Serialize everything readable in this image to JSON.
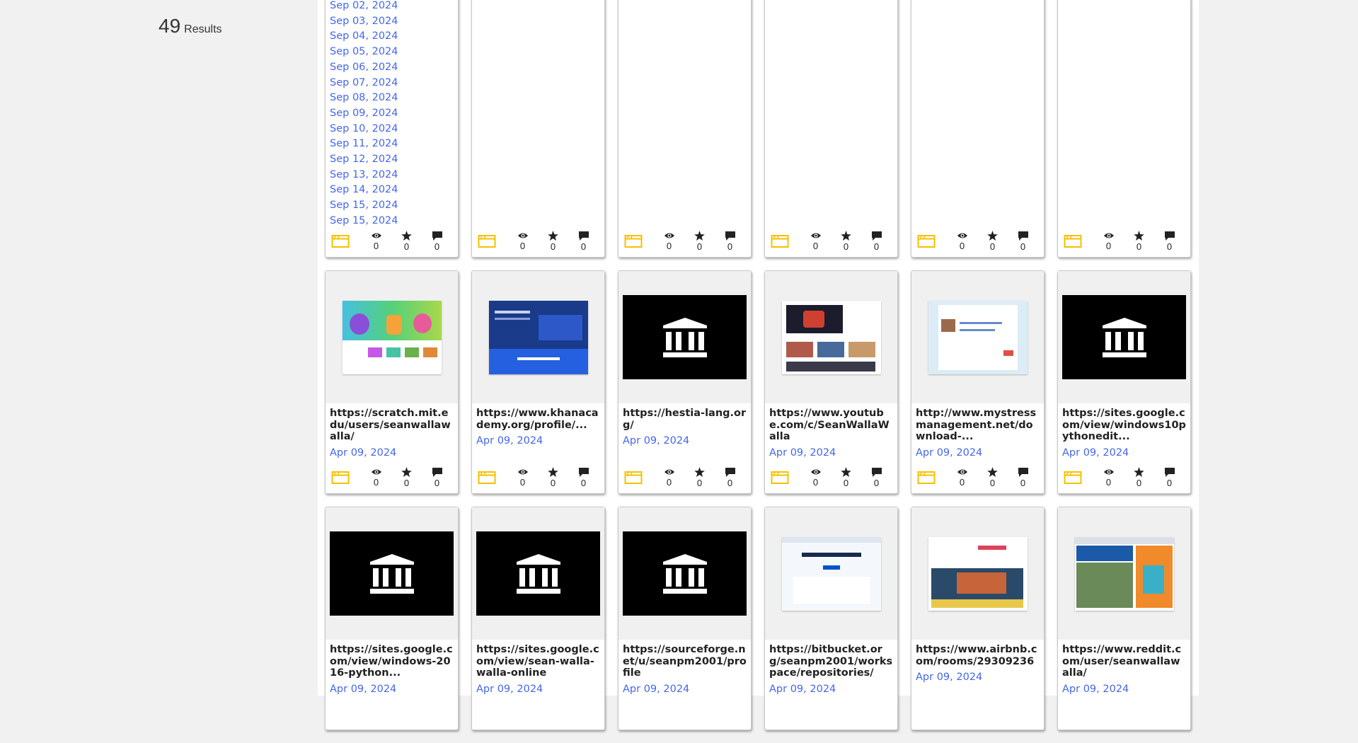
{
  "results": {
    "count": "49",
    "label": "Results"
  },
  "row0": [
    {
      "dates": [
        "Sep 02, 2024",
        "Sep 03, 2024",
        "Sep 04, 2024",
        "Sep 05, 2024",
        "Sep 06, 2024",
        "Sep 07, 2024",
        "Sep 08, 2024",
        "Sep 09, 2024",
        "Sep 10, 2024",
        "Sep 11, 2024",
        "Sep 12, 2024",
        "Sep 13, 2024",
        "Sep 14, 2024",
        "Sep 15, 2024",
        "Sep 15, 2024"
      ],
      "views": "0",
      "favs": "0",
      "reviews": "0"
    },
    {
      "dates": [],
      "views": "0",
      "favs": "0",
      "reviews": "0"
    },
    {
      "dates": [],
      "views": "0",
      "favs": "0",
      "reviews": "0"
    },
    {
      "dates": [],
      "views": "0",
      "favs": "0",
      "reviews": "0"
    },
    {
      "dates": [],
      "views": "0",
      "favs": "0",
      "reviews": "0"
    },
    {
      "dates": [],
      "views": "0",
      "favs": "0",
      "reviews": "0"
    }
  ],
  "row1": [
    {
      "title": "https://scratch.mit.edu/users/seanwallawalla/",
      "date": "Apr 09, 2024",
      "thumb": "scratch",
      "views": "0",
      "favs": "0",
      "reviews": "0"
    },
    {
      "title": "https://www.khanacademy.org/profile/...",
      "date": "Apr 09, 2024",
      "thumb": "khan",
      "views": "0",
      "favs": "0",
      "reviews": "0"
    },
    {
      "title": "https://hestia-lang.org/",
      "date": "Apr 09, 2024",
      "thumb": "archive",
      "views": "0",
      "favs": "0",
      "reviews": "0"
    },
    {
      "title": "https://www.youtube.com/c/SeanWallaWalla",
      "date": "Apr 09, 2024",
      "thumb": "youtube",
      "views": "0",
      "favs": "0",
      "reviews": "0"
    },
    {
      "title": "http://www.mystressmanagement.net/download-...",
      "date": "Apr 09, 2024",
      "thumb": "stress",
      "views": "0",
      "favs": "0",
      "reviews": "0"
    },
    {
      "title": "https://sites.google.com/view/windows10pythonedit...",
      "date": "Apr 09, 2024",
      "thumb": "archive",
      "views": "0",
      "favs": "0",
      "reviews": "0"
    }
  ],
  "row2": [
    {
      "title": "https://sites.google.com/view/windows-2016-python...",
      "date": "Apr 09, 2024",
      "thumb": "archive"
    },
    {
      "title": "https://sites.google.com/view/sean-walla-walla-online",
      "date": "Apr 09, 2024",
      "thumb": "archive"
    },
    {
      "title": "https://sourceforge.net/u/seanpm2001/profile",
      "date": "Apr 09, 2024",
      "thumb": "archive"
    },
    {
      "title": "https://bitbucket.org/seanpm2001/workspace/repositories/",
      "date": "Apr 09, 2024",
      "thumb": "bitbucket"
    },
    {
      "title": "https://www.airbnb.com/rooms/29309236",
      "date": "Apr 09, 2024",
      "thumb": "airbnb"
    },
    {
      "title": "https://www.reddit.com/user/seanwallawalla/",
      "date": "Apr 09, 2024",
      "thumb": "reddit"
    }
  ],
  "icons": {
    "type": "web-type-icon",
    "views": "eye-icon",
    "favs": "star-icon",
    "reviews": "comment-icon"
  },
  "colors": {
    "link": "#4466ee",
    "type_icon": "#f5c000",
    "page_bg": "#f1f1f1"
  }
}
